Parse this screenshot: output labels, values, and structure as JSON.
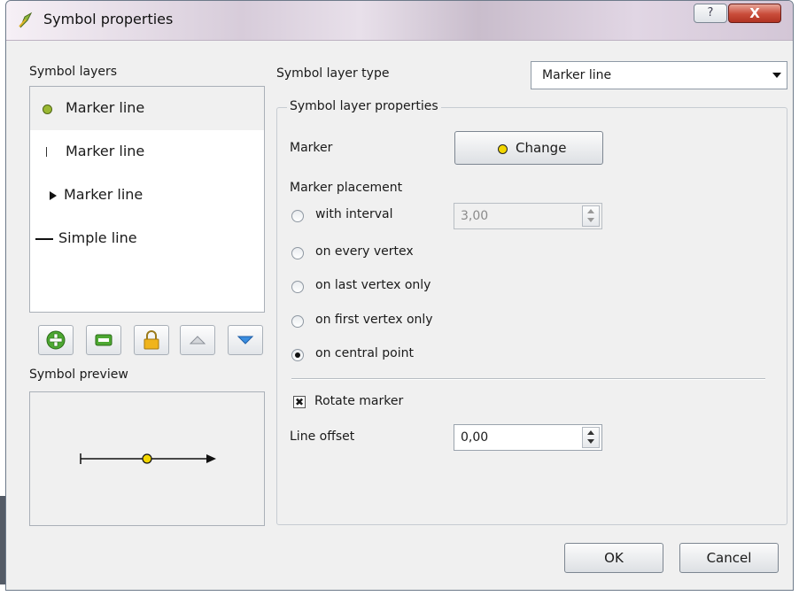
{
  "window": {
    "title": "Symbol properties",
    "help_label": "?",
    "close_label": "X"
  },
  "symbol_layers": {
    "heading": "Symbol layers",
    "items": [
      {
        "label": "Marker line",
        "icon": "yellow-dot-icon",
        "selected": true
      },
      {
        "label": "Marker line",
        "icon": "vertical-tick-icon",
        "selected": false
      },
      {
        "label": "Marker line",
        "icon": "triangle-right-icon",
        "selected": false
      },
      {
        "label": "Simple line",
        "icon": "horizontal-line-icon",
        "selected": false
      }
    ],
    "toolbar": [
      "add-layer",
      "remove-layer",
      "lock-layer",
      "move-up",
      "move-down"
    ]
  },
  "symbol_preview": {
    "heading": "Symbol preview"
  },
  "layer_type": {
    "label": "Symbol layer type",
    "selected": "Marker line"
  },
  "properties": {
    "title": "Symbol layer properties",
    "marker_label": "Marker",
    "change_button": "Change",
    "placement_label": "Marker placement",
    "interval_value": "3,00",
    "placements": [
      {
        "label": "with interval",
        "checked": false
      },
      {
        "label": "on every vertex",
        "checked": false
      },
      {
        "label": "on last vertex only",
        "checked": false
      },
      {
        "label": "on first vertex only",
        "checked": false
      },
      {
        "label": "on central point",
        "checked": true
      }
    ],
    "rotate_label": "Rotate marker",
    "rotate_checked": true,
    "rotate_mark": "✖",
    "offset_label": "Line offset",
    "offset_value": "0,00"
  },
  "buttons": {
    "ok": "OK",
    "cancel": "Cancel"
  },
  "colors": {
    "marker_fill": "#f2d600",
    "selection_dot": "#9ab833"
  }
}
